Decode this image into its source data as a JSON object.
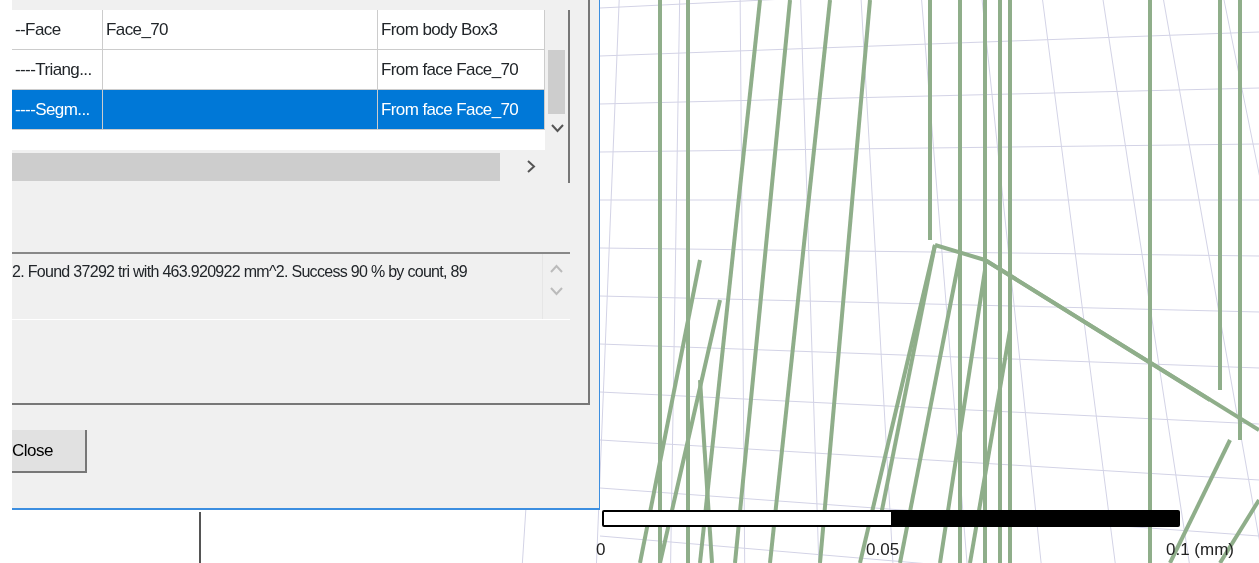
{
  "results_table": {
    "rows": [
      {
        "cells": [
          "--Face",
          "Face_70",
          "From body Box3"
        ],
        "selected": false
      },
      {
        "cells": [
          "----Triang...",
          "",
          "From face Face_70"
        ],
        "selected": false
      },
      {
        "cells": [
          "----Segm...",
          "",
          "From face Face_70"
        ],
        "selected": true
      }
    ]
  },
  "message": "2. Found 37292 tri with 463.920922 mm^2. Success 90 % by count, 89",
  "buttons": [
    "Close"
  ],
  "scale_bar": {
    "labels": [
      "0",
      "0.05",
      "0.1 (mm)"
    ]
  }
}
